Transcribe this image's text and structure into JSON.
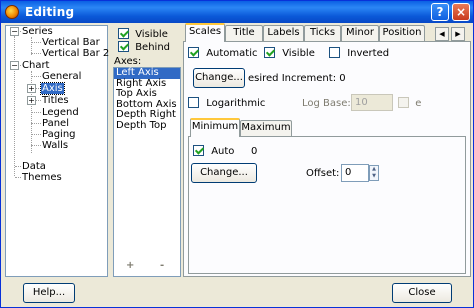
{
  "window": {
    "title": "Editing",
    "help_glyph": "?",
    "close_glyph": "×"
  },
  "tree": {
    "series": "Series",
    "vertical_bar": "Vertical Bar",
    "vertical_bar_2": "Vertical Bar 2",
    "chart": "Chart",
    "general": "General",
    "axis": "Axis",
    "titles": "Titles",
    "legend": "Legend",
    "panel": "Panel",
    "paging": "Paging",
    "walls": "Walls",
    "data": "Data",
    "themes": "Themes"
  },
  "axes_panel": {
    "visible_label": "Visible",
    "behind_label": "Behind",
    "axes_label": "Axes:",
    "items": [
      "Left Axis",
      "Right Axis",
      "Top Axis",
      "Bottom Axis",
      "Depth Right",
      "Depth Top"
    ],
    "selected_index": 0,
    "add_glyph": "+",
    "remove_glyph": "-"
  },
  "tabs": [
    "Scales",
    "Title",
    "Labels",
    "Ticks",
    "Minor",
    "Position"
  ],
  "active_tab": "Scales",
  "scales": {
    "automatic_label": "Automatic",
    "visible_label": "Visible",
    "inverted_label": "Inverted",
    "change_label": "Change...",
    "desired_increment_label": "esired Increment: 0",
    "logarithmic_label": "Logarithmic",
    "log_base_label": "Log Base:",
    "log_base_value": "10",
    "e_label": "e"
  },
  "subtabs": [
    "Minimum",
    "Maximum"
  ],
  "minimum": {
    "auto_label": "Auto",
    "value": "0",
    "change_label": "Change...",
    "offset_label": "Offset:",
    "offset_value": "0"
  },
  "footer": {
    "help_label": "Help...",
    "close_label": "Close"
  }
}
